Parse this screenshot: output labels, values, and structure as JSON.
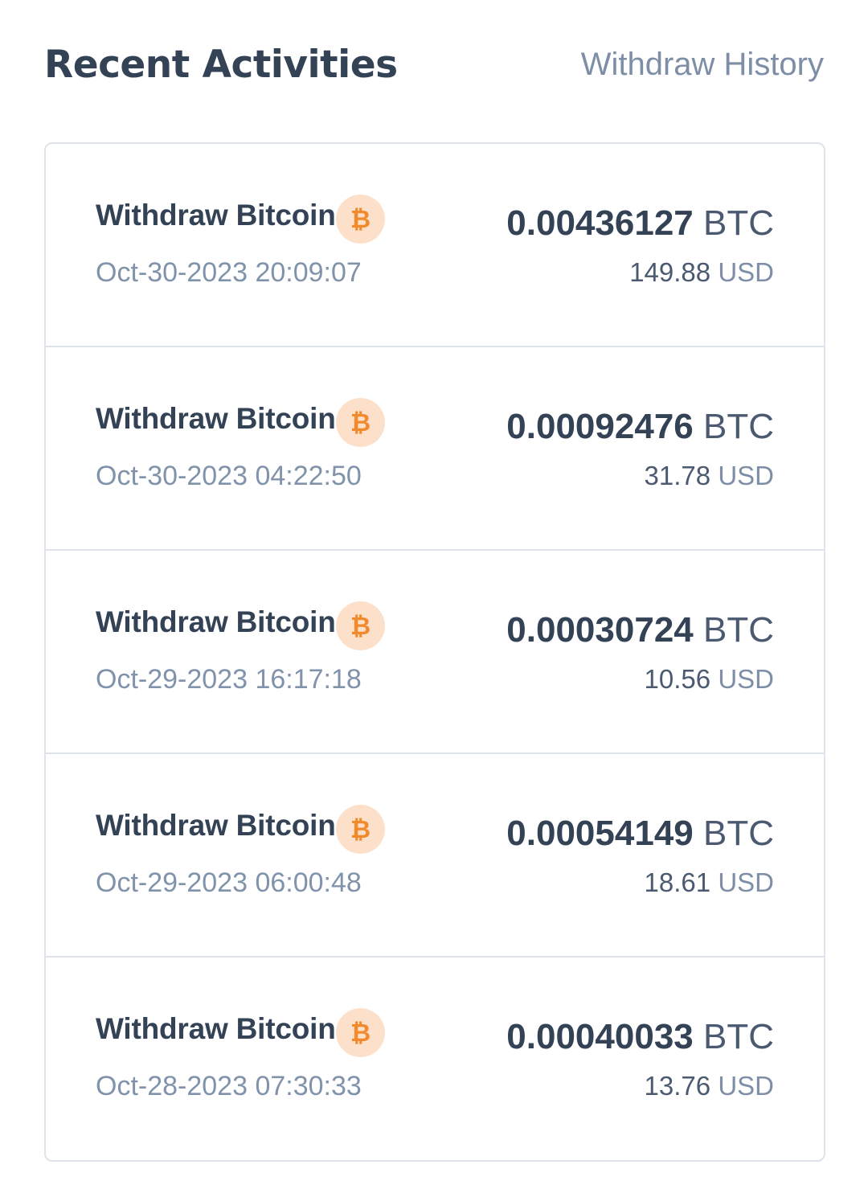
{
  "header": {
    "title": "Recent Activities",
    "history_link": "Withdraw History"
  },
  "colors": {
    "title": "#344256",
    "muted": "#7d8ea6",
    "border": "#dfe3ea",
    "bitcoin_orange": "#f08a2c",
    "bitcoin_badge_bg": "#fde0c9"
  },
  "activities": [
    {
      "label": "Withdraw Bitcoin",
      "icon": "bitcoin-icon",
      "icon_glyph": "₿",
      "date": "Oct-30-2023 20:09:07",
      "amount": "0.00436127",
      "amount_unit": "BTC",
      "fiat_value": "149.88",
      "fiat_unit": "USD"
    },
    {
      "label": "Withdraw Bitcoin",
      "icon": "bitcoin-icon",
      "icon_glyph": "₿",
      "date": "Oct-30-2023 04:22:50",
      "amount": "0.00092476",
      "amount_unit": "BTC",
      "fiat_value": "31.78",
      "fiat_unit": "USD"
    },
    {
      "label": "Withdraw Bitcoin",
      "icon": "bitcoin-icon",
      "icon_glyph": "₿",
      "date": "Oct-29-2023 16:17:18",
      "amount": "0.00030724",
      "amount_unit": "BTC",
      "fiat_value": "10.56",
      "fiat_unit": "USD"
    },
    {
      "label": "Withdraw Bitcoin",
      "icon": "bitcoin-icon",
      "icon_glyph": "₿",
      "date": "Oct-29-2023 06:00:48",
      "amount": "0.00054149",
      "amount_unit": "BTC",
      "fiat_value": "18.61",
      "fiat_unit": "USD"
    },
    {
      "label": "Withdraw Bitcoin",
      "icon": "bitcoin-icon",
      "icon_glyph": "₿",
      "date": "Oct-28-2023 07:30:33",
      "amount": "0.00040033",
      "amount_unit": "BTC",
      "fiat_value": "13.76",
      "fiat_unit": "USD"
    }
  ]
}
